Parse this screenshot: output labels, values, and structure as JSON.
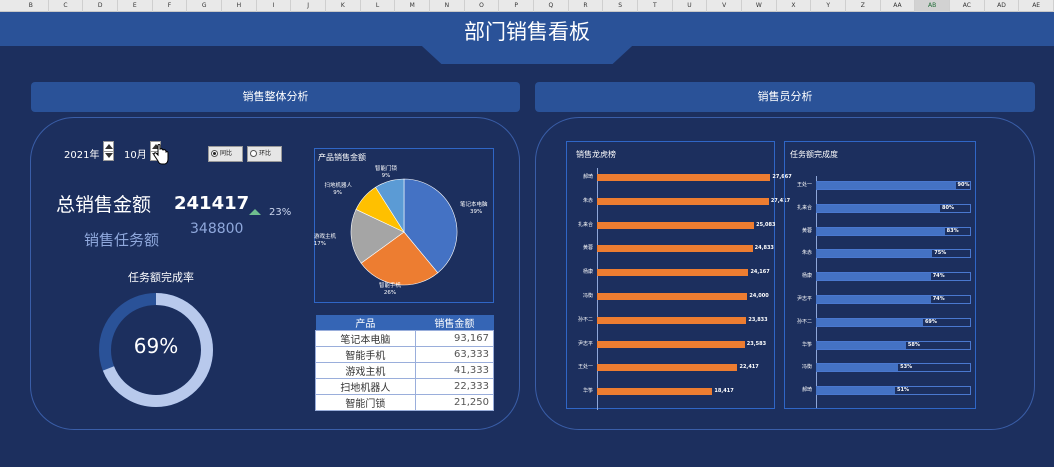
{
  "columns": [
    "B",
    "C",
    "D",
    "E",
    "F",
    "G",
    "H",
    "I",
    "J",
    "K",
    "L",
    "M",
    "N",
    "O",
    "P",
    "Q",
    "R",
    "S",
    "T",
    "U",
    "V",
    "W",
    "X",
    "Y",
    "Z",
    "AA",
    "AB",
    "AC",
    "AD",
    "AE"
  ],
  "selected_column": "AB",
  "title": "部门销售看板",
  "sections": {
    "left": "销售整体分析",
    "right": "销售员分析"
  },
  "controls": {
    "year": "2021年",
    "month": "10月",
    "option_yoy": "同比",
    "option_mom": "环比"
  },
  "kpi": {
    "total_label": "总销售金额",
    "total_value": "241417",
    "change": "23%",
    "target_label": "销售任务额",
    "target_value": "348800",
    "completion_title": "任务额完成率",
    "completion_text": "69%",
    "completion_value": 0.69
  },
  "pie": {
    "title": "产品销售金额",
    "slices": [
      {
        "name": "笔记本电脑",
        "pct": "39%",
        "value": 0.39,
        "color": "#4472c4"
      },
      {
        "name": "智能手机",
        "pct": "26%",
        "value": 0.26,
        "color": "#ed7d31"
      },
      {
        "name": "游戏主机",
        "pct": "17%",
        "value": 0.17,
        "color": "#a5a5a5"
      },
      {
        "name": "扫地机器人",
        "pct": "9%",
        "value": 0.09,
        "color": "#ffc000"
      },
      {
        "name": "智能门锁",
        "pct": "9%",
        "value": 0.09,
        "color": "#5b9bd5"
      }
    ]
  },
  "table": {
    "headers": [
      "产品",
      "销售金额"
    ],
    "rows": [
      [
        "笔记本电脑",
        "93,167"
      ],
      [
        "智能手机",
        "63,333"
      ],
      [
        "游戏主机",
        "41,333"
      ],
      [
        "扫地机器人",
        "22,333"
      ],
      [
        "智能门锁",
        "21,250"
      ]
    ]
  },
  "chart_data": [
    {
      "type": "bar",
      "title": "销售龙虎榜",
      "categories": [
        "郝琦",
        "朱赤",
        "扎来合",
        "黄蓉",
        "杨康",
        "冯衡",
        "孙不二",
        "尹志平",
        "王处一",
        "华筝"
      ],
      "values": [
        27667,
        27417,
        25083,
        24833,
        24167,
        24000,
        23833,
        23583,
        22417,
        18417
      ],
      "value_labels": [
        "27,667",
        "27,417",
        "25,083",
        "24,833",
        "24,167",
        "24,000",
        "23,833",
        "23,583",
        "22,417",
        "18,417"
      ],
      "xlim": [
        0,
        30000
      ],
      "color": "#ed7d31"
    },
    {
      "type": "bar",
      "title": "任务额完成度",
      "categories": [
        "王处一",
        "扎来合",
        "黄蓉",
        "朱赤",
        "杨康",
        "尹志平",
        "孙不二",
        "华筝",
        "冯衡",
        "郝琦"
      ],
      "values": [
        0.9,
        0.8,
        0.83,
        0.75,
        0.74,
        0.74,
        0.69,
        0.58,
        0.53,
        0.51
      ],
      "value_labels": [
        "90%",
        "80%",
        "83%",
        "75%",
        "74%",
        "74%",
        "69%",
        "58%",
        "53%",
        "51%"
      ],
      "xlim": [
        0,
        1
      ],
      "color": "#4472c4"
    }
  ]
}
